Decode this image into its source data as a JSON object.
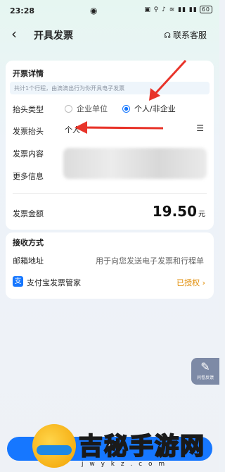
{
  "status_bar": {
    "time": "23:28",
    "indicators": "▣ ⚲ ♪ ≋ ▮▮ ▮▮",
    "battery": "60"
  },
  "header": {
    "title": "开具发票",
    "service_label": "联系客服"
  },
  "invoice_details": {
    "section_title": "开票详情",
    "hint": "共计1个行程，由滴滴出行为你开具电子发票",
    "header_type_label": "抬头类型",
    "option_company": "企业单位",
    "option_personal": "个人/非企业",
    "selected_option": "个人/非企业",
    "invoice_header_label": "发票抬头",
    "invoice_header_value": "个人",
    "content_label": "发票内容",
    "more_info_label": "更多信息",
    "amount_label": "发票金额",
    "amount_value": "19.50",
    "amount_unit": "元"
  },
  "receive": {
    "section_title": "接收方式",
    "email_label": "邮箱地址",
    "email_placeholder": "用于向您发送电子发票和行程单",
    "alipay_icon_text": "支",
    "alipay_label": "支付宝发票管家",
    "alipay_status": "已授权",
    "chevron": "›"
  },
  "float_button": {
    "label": "问卷反馈"
  },
  "watermark": {
    "text": "吉秘手游网",
    "url": "j w y k z . c o m"
  },
  "colors": {
    "accent": "#1677ff",
    "authorized": "#e08a00",
    "arrow": "#e8342a"
  }
}
